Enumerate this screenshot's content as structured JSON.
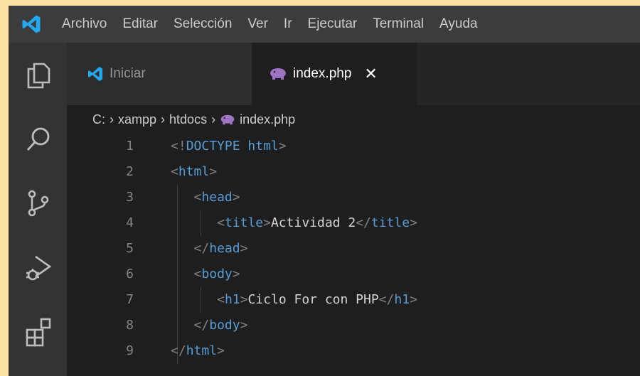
{
  "menu": [
    "Archivo",
    "Editar",
    "Selección",
    "Ver",
    "Ir",
    "Ejecutar",
    "Terminal",
    "Ayuda"
  ],
  "tabs": [
    {
      "label": "Iniciar",
      "active": false
    },
    {
      "label": "index.php",
      "active": true,
      "close": "✕"
    }
  ],
  "breadcrumb": [
    "C:",
    "xampp",
    "htdocs",
    "index.php"
  ],
  "breadcrumb_sep": "›",
  "code_lines": [
    {
      "num": "1",
      "indent": 0,
      "tokens": [
        {
          "c": "p",
          "v": "<!"
        },
        {
          "c": "t",
          "v": "DOCTYPE "
        },
        {
          "c": "t",
          "v": "html"
        },
        {
          "c": "p",
          "v": ">"
        }
      ]
    },
    {
      "num": "2",
      "indent": 0,
      "tokens": [
        {
          "c": "p",
          "v": "<"
        },
        {
          "c": "t",
          "v": "html"
        },
        {
          "c": "p",
          "v": ">"
        }
      ]
    },
    {
      "num": "3",
      "indent": 1,
      "tokens": [
        {
          "c": "p",
          "v": "<"
        },
        {
          "c": "t",
          "v": "head"
        },
        {
          "c": "p",
          "v": ">"
        }
      ]
    },
    {
      "num": "4",
      "indent": 2,
      "tokens": [
        {
          "c": "p",
          "v": "<"
        },
        {
          "c": "t",
          "v": "title"
        },
        {
          "c": "p",
          "v": ">"
        },
        {
          "c": "txt",
          "v": "Actividad 2"
        },
        {
          "c": "p",
          "v": "</"
        },
        {
          "c": "t",
          "v": "title"
        },
        {
          "c": "p",
          "v": ">"
        }
      ]
    },
    {
      "num": "5",
      "indent": 1,
      "tokens": [
        {
          "c": "p",
          "v": "</"
        },
        {
          "c": "t",
          "v": "head"
        },
        {
          "c": "p",
          "v": ">"
        }
      ]
    },
    {
      "num": "6",
      "indent": 1,
      "tokens": [
        {
          "c": "p",
          "v": "<"
        },
        {
          "c": "t",
          "v": "body"
        },
        {
          "c": "p",
          "v": ">"
        }
      ]
    },
    {
      "num": "7",
      "indent": 2,
      "tokens": [
        {
          "c": "p",
          "v": "<"
        },
        {
          "c": "t",
          "v": "h1"
        },
        {
          "c": "p",
          "v": ">"
        },
        {
          "c": "txt",
          "v": "Ciclo For con PHP"
        },
        {
          "c": "p",
          "v": "</"
        },
        {
          "c": "t",
          "v": "h1"
        },
        {
          "c": "p",
          "v": ">"
        }
      ]
    },
    {
      "num": "8",
      "indent": 1,
      "tokens": [
        {
          "c": "p",
          "v": "</"
        },
        {
          "c": "t",
          "v": "body"
        },
        {
          "c": "p",
          "v": ">"
        }
      ]
    },
    {
      "num": "9",
      "indent": 0,
      "tokens": [
        {
          "c": "p",
          "v": "</"
        },
        {
          "c": "t",
          "v": "html"
        },
        {
          "c": "p",
          "v": ">"
        }
      ]
    }
  ],
  "colors": {
    "background_outer": "#fbe2a4",
    "editor_bg": "#1e1e1e",
    "titlebar_bg": "#3c3c3c",
    "activity_bg": "#333333",
    "tag_blue": "#569cd6",
    "punct_gray": "#808080",
    "vscode_blue": "#23a9f2",
    "php_purple": "#a074c4"
  },
  "icons": {
    "app": "vscode-logo-icon",
    "activity": [
      "explorer-icon",
      "search-icon",
      "source-control-icon",
      "run-debug-icon",
      "extensions-icon"
    ],
    "tab_iniciar": "vscode-logo-icon",
    "tab_php": "php-elephant-icon"
  }
}
